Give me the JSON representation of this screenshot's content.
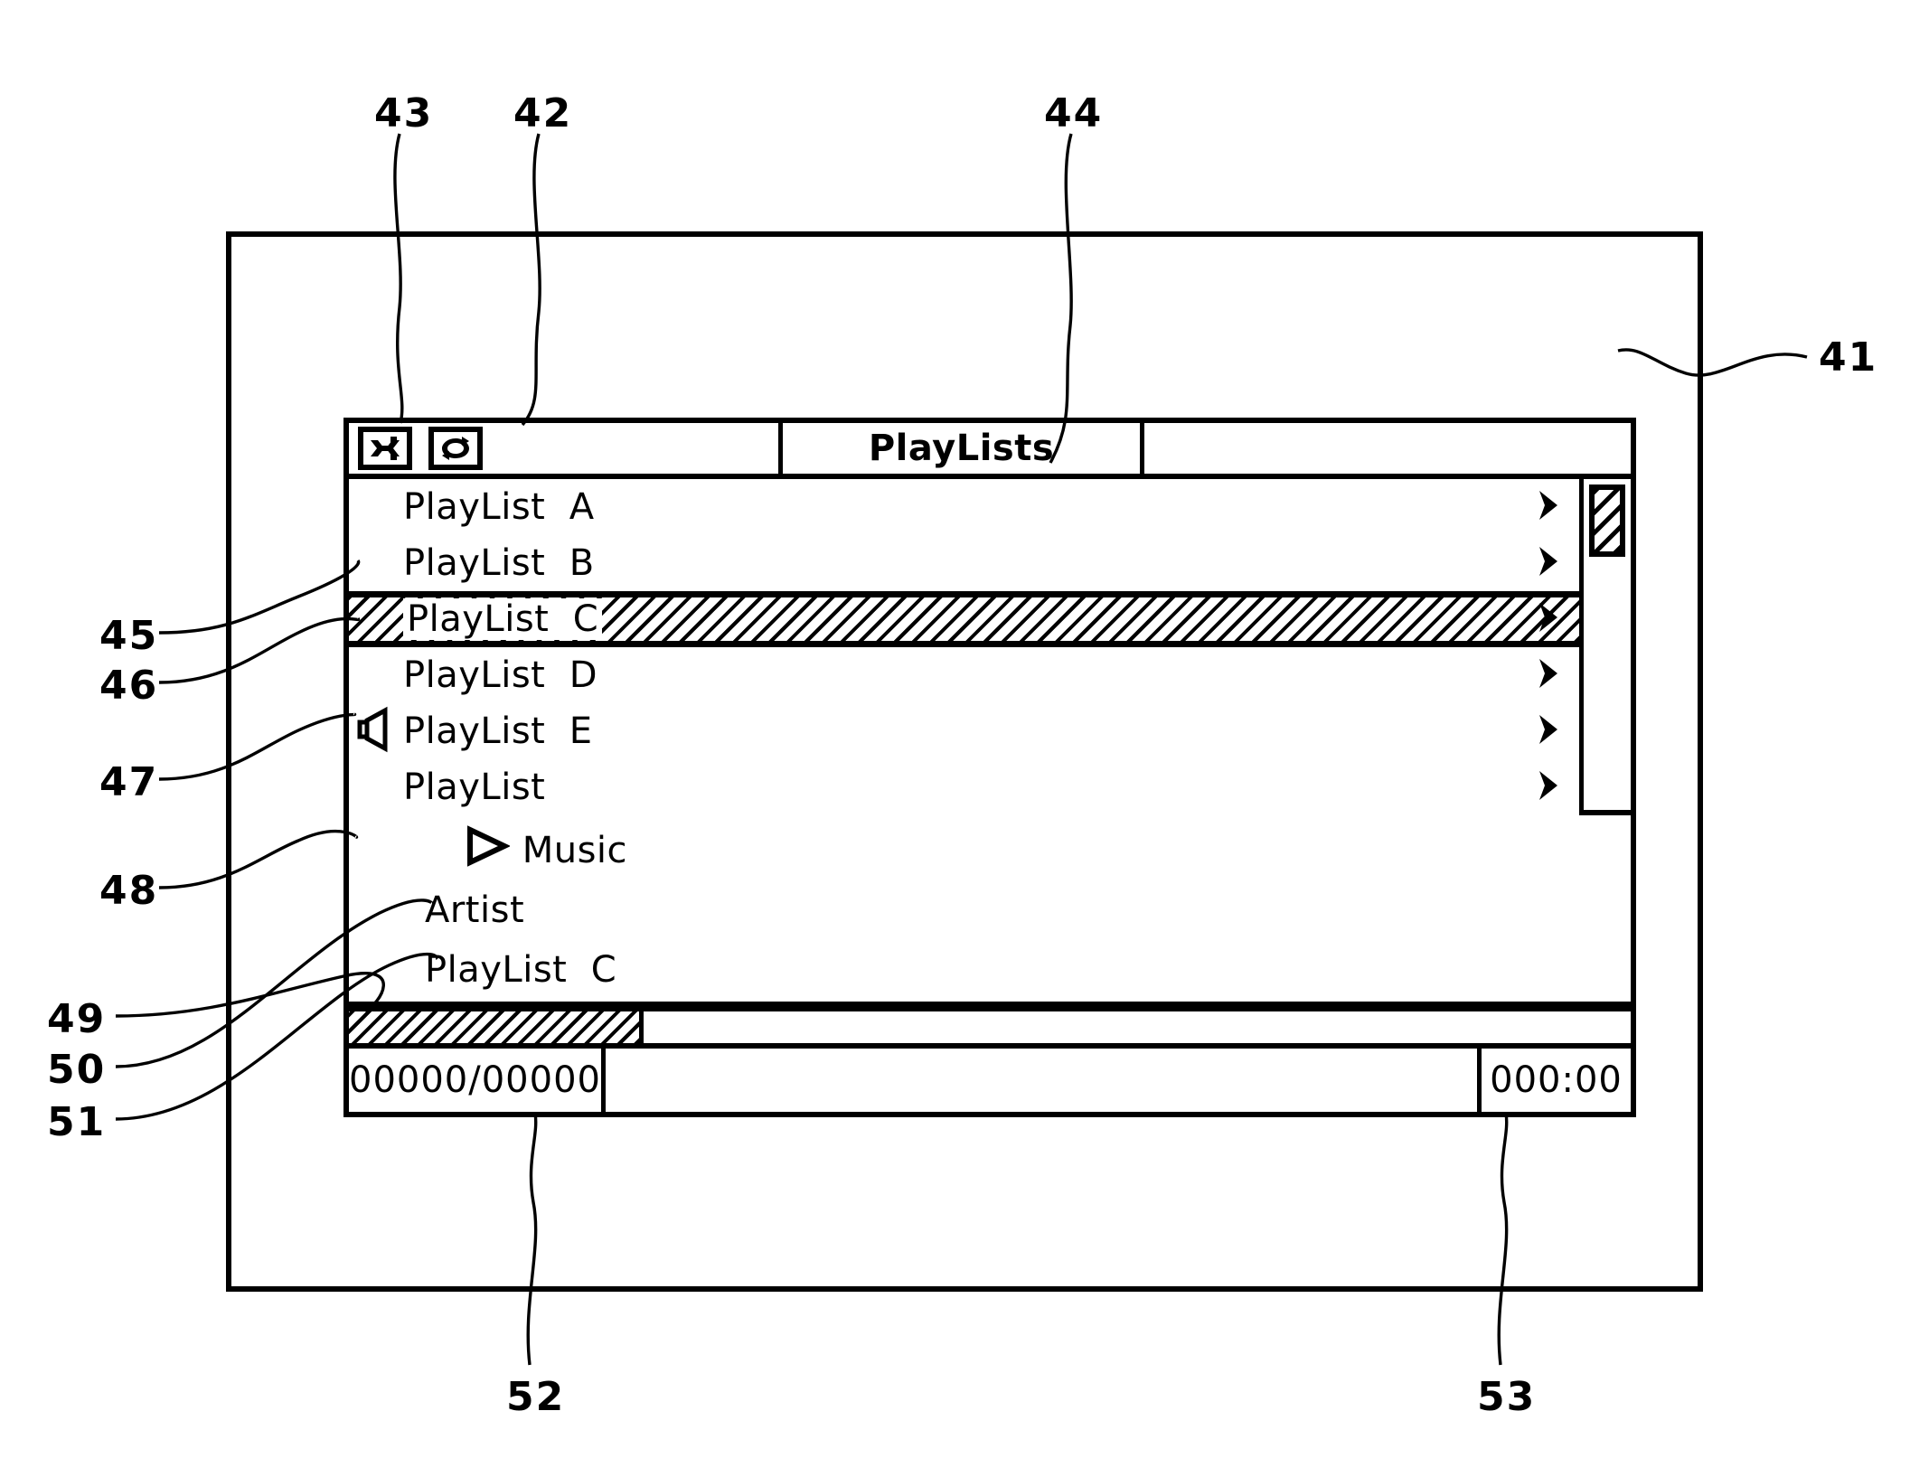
{
  "figure": {
    "reference_numbers": [
      {
        "id": "41",
        "label": "41"
      },
      {
        "id": "42",
        "label": "42"
      },
      {
        "id": "43",
        "label": "43"
      },
      {
        "id": "44",
        "label": "44"
      },
      {
        "id": "45",
        "label": "45"
      },
      {
        "id": "46",
        "label": "46"
      },
      {
        "id": "47",
        "label": "47"
      },
      {
        "id": "48",
        "label": "48"
      },
      {
        "id": "49",
        "label": "49"
      },
      {
        "id": "50",
        "label": "50"
      },
      {
        "id": "51",
        "label": "51"
      },
      {
        "id": "52",
        "label": "52"
      },
      {
        "id": "53",
        "label": "53"
      }
    ]
  },
  "title_bar": {
    "shuffle_icon": "shuffle-icon",
    "repeat_icon": "repeat-icon",
    "title": "PlayLists",
    "right_cell": ""
  },
  "list": {
    "chevron_icon": "chevron-right-icon",
    "speaker_icon": "speaker-icon",
    "rows": [
      {
        "label": "PlayList  A",
        "selected": false,
        "speaker": false
      },
      {
        "label": "PlayList  B",
        "selected": false,
        "speaker": false
      },
      {
        "label": "PlayList  C",
        "selected": true,
        "speaker": false
      },
      {
        "label": "PlayList  D",
        "selected": false,
        "speaker": false
      },
      {
        "label": "PlayList  E",
        "selected": false,
        "speaker": true
      },
      {
        "label": "PlayList",
        "selected": false,
        "speaker": false
      }
    ],
    "scrollbar": {
      "thumb_position": "top"
    }
  },
  "now_playing": {
    "play_icon": "play-triangle-icon",
    "track": "Music",
    "artist": "Artist",
    "playlist": "PlayList  C"
  },
  "progress": {
    "percent": 23
  },
  "status_bar": {
    "track_counter": "00000/00000",
    "middle": "",
    "elapsed_time": "000:00"
  },
  "colors": {
    "ink": "#000000",
    "paper": "#ffffff"
  }
}
